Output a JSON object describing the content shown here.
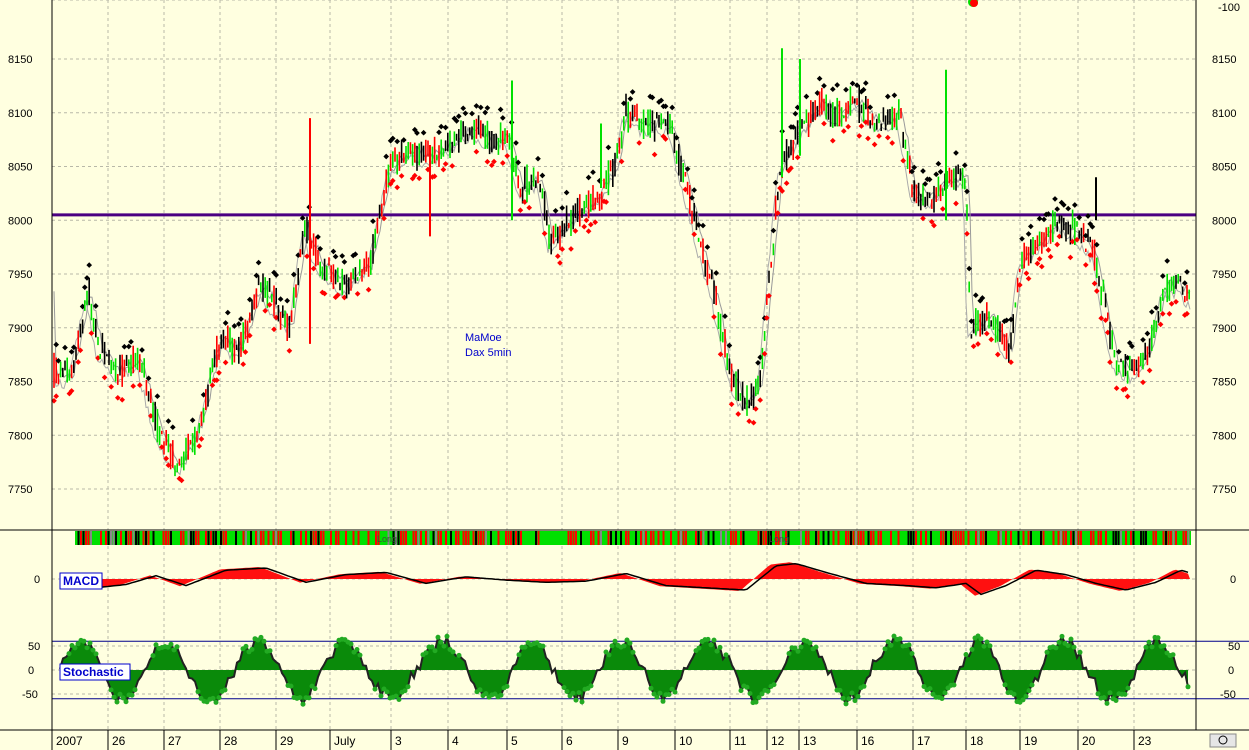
{
  "colors": {
    "background": "#ffffe0",
    "grid": "#b8b8a8",
    "up": "#00e000",
    "down": "#ff0000",
    "bar": "#000000",
    "support_line": "#4b0082",
    "macd_hist": "#ff1010",
    "stoch_fill": "#0a8a0a",
    "stoch_marker": "#22aa22",
    "label_text": "#0000cc"
  },
  "price_panel": {
    "annotation_line1": "MaMoe",
    "annotation_line2": "Dax 5min",
    "y_ticks": [
      7750,
      7800,
      7850,
      7900,
      7950,
      8000,
      8050,
      8100,
      8150
    ],
    "top_tick_label": "-100",
    "horizontal_level": 8005
  },
  "signal_band": {
    "labels": [
      "Long",
      "Long"
    ]
  },
  "macd_panel": {
    "label": "MACD",
    "y_ticks": [
      0
    ]
  },
  "stoch_panel": {
    "label": "Stochastic",
    "y_ticks": [
      50,
      0,
      -50
    ],
    "upper_line": 60,
    "lower_line": -60
  },
  "x_axis": {
    "labels": [
      "2007",
      "26",
      "27",
      "28",
      "29",
      "July",
      "3",
      "4",
      "5",
      "6",
      "9",
      "10",
      "11",
      "12",
      "13",
      "16",
      "17",
      "18",
      "19",
      "20",
      "23"
    ]
  },
  "chart_data": {
    "type": "line",
    "title": "",
    "xlabel": "",
    "ylabel": "",
    "ylim": [
      7710,
      8185
    ],
    "x": [
      "2007",
      "26",
      "27",
      "28",
      "29",
      "July",
      "3",
      "4",
      "5",
      "6",
      "9",
      "10",
      "11",
      "12",
      "13",
      "16",
      "17",
      "18",
      "19",
      "20",
      "23"
    ],
    "series": [
      {
        "name": "Dax 5min",
        "values": [
          7860,
          7930,
          7790,
          7900,
          7950,
          7960,
          8065,
          8075,
          8080,
          7980,
          8100,
          8000,
          7830,
          7900,
          8110,
          8100,
          8030,
          7900,
          7990,
          7990,
          7930
        ]
      }
    ],
    "support_level": 8005,
    "macd_ylim": [
      -1,
      1
    ],
    "stochastic_ylim": [
      -80,
      80
    ],
    "stochastic_bands": [
      60,
      -60
    ]
  }
}
